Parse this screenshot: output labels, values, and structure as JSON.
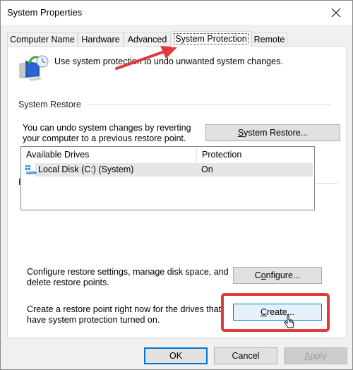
{
  "window": {
    "title": "System Properties",
    "close_icon": "close-icon"
  },
  "tabs": [
    {
      "label": "Computer Name",
      "active": false
    },
    {
      "label": "Hardware",
      "active": false
    },
    {
      "label": "Advanced",
      "active": false
    },
    {
      "label": "System Protection",
      "active": true
    },
    {
      "label": "Remote",
      "active": false
    }
  ],
  "intro": {
    "icon": "system-protection-icon",
    "text": "Use system protection to undo unwanted system changes."
  },
  "system_restore": {
    "group_label": "System Restore",
    "description_line1": "You can undo system changes by reverting",
    "description_line2": "your computer to a previous restore point.",
    "button_label_accel": "S",
    "button_label_rest": "ystem Restore..."
  },
  "protection_settings": {
    "group_label": "Protection Settings",
    "columns": [
      "Available Drives",
      "Protection"
    ],
    "rows": [
      {
        "drive": "Local Disk (C:) (System)",
        "protection": "On",
        "icon": "drive-icon"
      }
    ],
    "configure_description_line1": "Configure restore settings, manage disk space, and",
    "configure_description_line2": "delete restore points.",
    "configure_button_pre": "C",
    "configure_button_accel": "o",
    "configure_button_rest": "nfigure...",
    "create_description_line1": "Create a restore point right now for the drives that",
    "create_description_line2": "have system protection turned on.",
    "create_button_accel": "C",
    "create_button_rest": "reate..."
  },
  "footer": {
    "ok_label": "OK",
    "cancel_label": "Cancel",
    "apply_accel": "A",
    "apply_rest": "pply"
  },
  "annotations": {
    "highlight_color": "#e03a3e",
    "arrow_color": "#e03a3e"
  }
}
